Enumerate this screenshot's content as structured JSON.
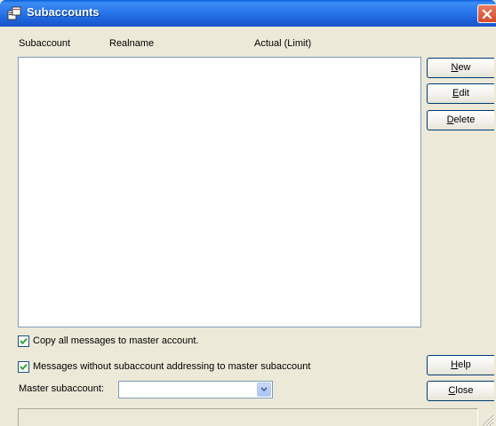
{
  "window": {
    "title": "Subaccounts"
  },
  "list": {
    "columns": [
      "Subaccount",
      "Realname",
      "Actual (Limit)"
    ],
    "rows": []
  },
  "buttons": {
    "new": {
      "mnemonic": "N",
      "rest": "ew"
    },
    "edit": {
      "mnemonic": "E",
      "rest": "dit"
    },
    "delete": {
      "mnemonic": "D",
      "rest": "elete"
    },
    "help": {
      "mnemonic": "H",
      "rest": "elp"
    },
    "close": {
      "mnemonic": "C",
      "rest": "lose"
    }
  },
  "options": {
    "copy_all": {
      "label": "Copy all messages to master account.",
      "checked": true
    },
    "without_addressing": {
      "label": "Messages without subaccount addressing to master subaccount",
      "checked": true
    }
  },
  "master": {
    "label": "Master subaccount:",
    "value": ""
  },
  "icons": {
    "title": "window-app-icon",
    "close": "close-x-icon",
    "dropdown": "chevron-down-icon",
    "check": "checkmark-icon",
    "grip": "resize-grip-icon"
  },
  "colors": {
    "titlebar": "#2a76ec",
    "dialog_bg": "#ece9d8",
    "close_button": "#d44a2b",
    "check": "#21a121"
  }
}
